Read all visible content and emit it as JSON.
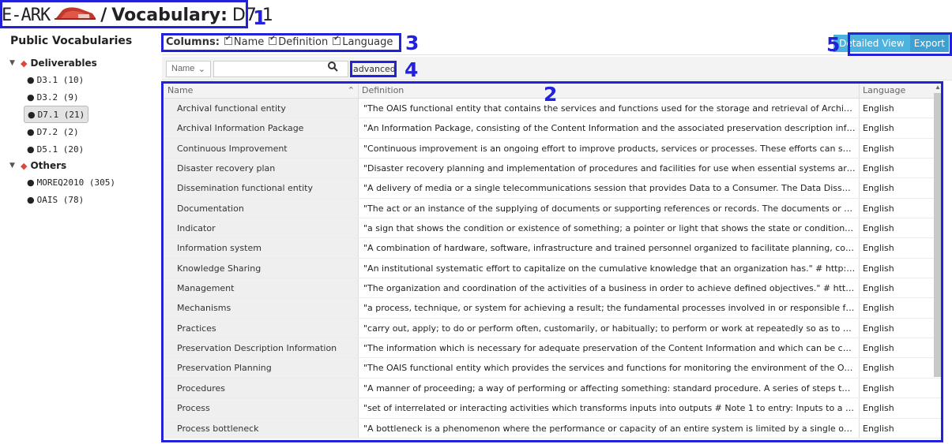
{
  "header": {
    "brand": "E-ARK",
    "separator": "/",
    "vocab_label": "Vocabulary:",
    "vocab_name": "D7.1"
  },
  "sidebar": {
    "title": "Public Vocabularies",
    "groups": [
      {
        "label": "Deliverables",
        "items": [
          {
            "label": "D3.1 (10)",
            "active": false
          },
          {
            "label": "D3.2 (9)",
            "active": false
          },
          {
            "label": "D7.1 (21)",
            "active": true
          },
          {
            "label": "D7.2 (2)",
            "active": false
          },
          {
            "label": "D5.1 (20)",
            "active": false
          }
        ]
      },
      {
        "label": "Others",
        "items": [
          {
            "label": "MOREQ2010 (305)",
            "active": false
          },
          {
            "label": "OAIS (78)",
            "active": false
          }
        ]
      }
    ]
  },
  "columns_bar": {
    "label": "Columns:",
    "options": [
      "Name",
      "Definition",
      "Language"
    ]
  },
  "buttons": {
    "detailed_view": "Detailed View",
    "export": "Export"
  },
  "search": {
    "field_select": "Name",
    "query": "",
    "advanced": "advanced"
  },
  "table": {
    "headers": [
      "Name",
      "Definition",
      "Language"
    ],
    "rows": [
      {
        "name": "Archival functional entity",
        "definition": "\"The OAIS functional entity that contains the services and functions used for the storage and retrieval of Archival Informati...",
        "language": "English"
      },
      {
        "name": "Archival Information Package",
        "definition": "\"An Information Package, consisting of the Content Information and the associated preservation description information (P...",
        "language": "English"
      },
      {
        "name": "Continuous Improvement",
        "definition": "\"Continuous improvement is an ongoing effort to improve products, services or processes. These efforts can seek \"increme...",
        "language": "English"
      },
      {
        "name": "Disaster recovery plan",
        "definition": "\"Disaster recovery planning and implementation of procedures and facilities for use when essential systems are not availab...",
        "language": "English"
      },
      {
        "name": "Dissemination functional entity",
        "definition": "\"A delivery of media or a single telecommunications session that provides Data to a Consumer. The Data Dissemination Se...",
        "language": "English"
      },
      {
        "name": "Documentation",
        "definition": "\"The act or an instance of the supplying of documents or supporting references or records. The documents or references s...",
        "language": "English"
      },
      {
        "name": "Indicator",
        "definition": "\"a sign that shows the condition or existence of something; a pointer or light that shows the state or condition of somethin...",
        "language": "English"
      },
      {
        "name": "Information system",
        "definition": "\"A combination of hardware, software, infrastructure and trained personnel organized to facilitate planning, control, coordi...",
        "language": "English"
      },
      {
        "name": "Knowledge Sharing",
        "definition": "\"An institutional systematic effort to capitalize on the cumulative knowledge that an organization has.\" # http://www.uky.e...",
        "language": "English"
      },
      {
        "name": "Management",
        "definition": "\"The organization and coordination of the activities of a business in order to achieve defined objectives.\" # http://www.busi...",
        "language": "English"
      },
      {
        "name": "Mechanisms",
        "definition": "\"a process, technique, or system for achieving a result; the fundamental processes involved in or responsible for an action, ...",
        "language": "English"
      },
      {
        "name": "Practices",
        "definition": "\"carry out, apply; to do or perform often, customarily, or habitually; to perform or work at repeatedly so as to become profi...",
        "language": "English"
      },
      {
        "name": "Preservation Description Information",
        "definition": "\"The information which is necessary for adequate preservation of the Content Information and which can be categorized as...",
        "language": "English"
      },
      {
        "name": "Preservation Planning",
        "definition": "\"The OAIS functional entity which provides the services and functions for monitoring the environment of the OAIS and whi...",
        "language": "English"
      },
      {
        "name": "Procedures",
        "definition": "\"A manner of proceeding; a way of performing or affecting something: standard procedure. A series of steps taken to acco...",
        "language": "English"
      },
      {
        "name": "Process",
        "definition": "\"set of interrelated or interacting activities which transforms inputs into outputs # Note 1 to entry: Inputs to a process are ...",
        "language": "English"
      },
      {
        "name": "Process bottleneck",
        "definition": "\"A bottleneck is a phenomenon where the performance or capacity of an entire system is limited by a single or limited nu...",
        "language": "English"
      }
    ]
  },
  "annotations": [
    "1",
    "2",
    "3",
    "4",
    "5"
  ],
  "colors": {
    "annotation": "#2222dd",
    "button": "#4cb3e0",
    "logo": "#c0392b"
  }
}
